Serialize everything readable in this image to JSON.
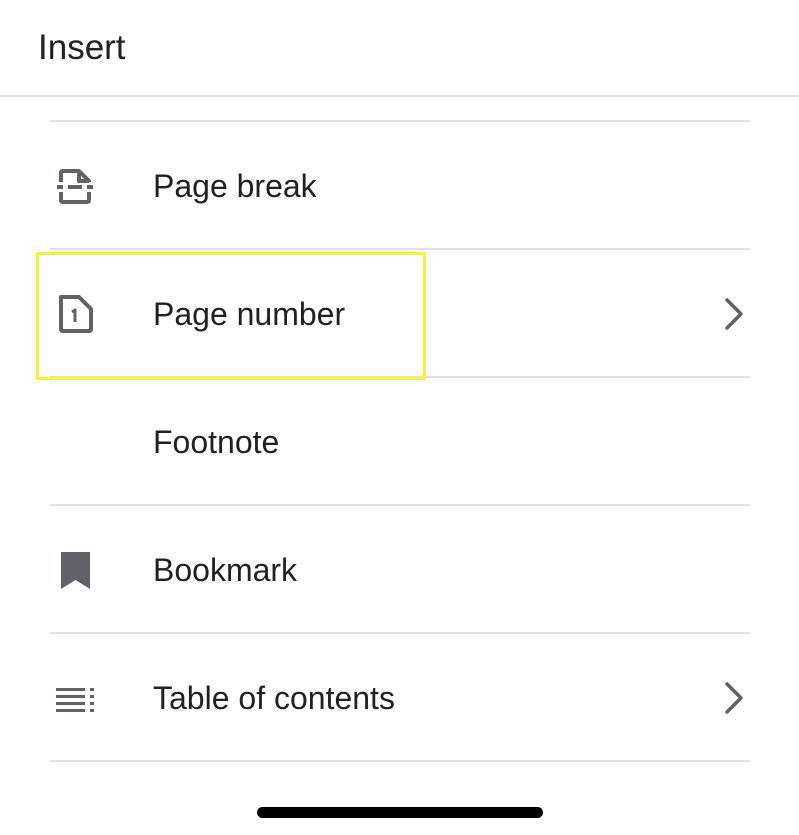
{
  "header": {
    "title": "Insert"
  },
  "menu": {
    "items": [
      {
        "label": "Page break",
        "icon": "page-break-icon",
        "has_submenu": false
      },
      {
        "label": "Page number",
        "icon": "page-number-icon",
        "has_submenu": true,
        "highlighted": true
      },
      {
        "label": "Footnote",
        "icon": null,
        "has_submenu": false
      },
      {
        "label": "Bookmark",
        "icon": "bookmark-icon",
        "has_submenu": false
      },
      {
        "label": "Table of contents",
        "icon": "table-of-contents-icon",
        "has_submenu": true
      }
    ]
  },
  "colors": {
    "text": "#202124",
    "icon": "#5f6368",
    "divider": "#e0e0e0",
    "highlight": "#f4f23a"
  }
}
